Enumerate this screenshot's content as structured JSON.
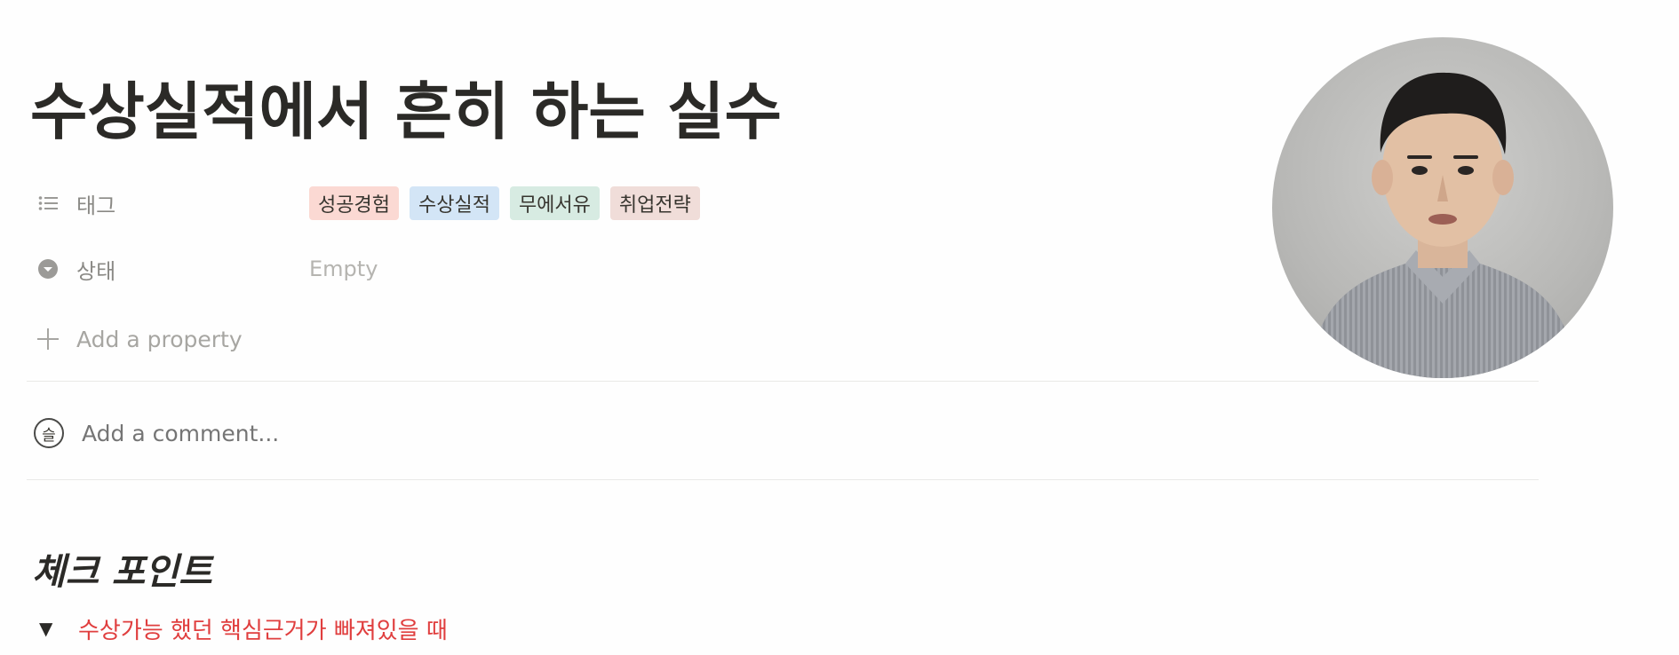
{
  "page": {
    "title": "수상실적에서 흔히 하는 실수"
  },
  "properties": {
    "tags": {
      "name": "태그",
      "icon": "list-icon",
      "values": [
        {
          "label": "성공경험",
          "color": "#fbd9d3"
        },
        {
          "label": "수상실적",
          "color": "#d3e5f6"
        },
        {
          "label": "무에서유",
          "color": "#d7ebe2"
        },
        {
          "label": "취업전략",
          "color": "#f0ddd9"
        }
      ]
    },
    "status": {
      "name": "상태",
      "icon": "status-icon",
      "value": "Empty"
    },
    "add_property": {
      "icon": "plus-icon",
      "label": "Add a property"
    }
  },
  "comment": {
    "avatar_letter": "슬",
    "placeholder": "Add a comment..."
  },
  "content": {
    "heading": "체크 포인트",
    "toggle": {
      "text": "수상가능 했던 핵심근거가 빠져있을 때",
      "color": "#e03e3e"
    }
  },
  "video_overlay": {
    "shape": "circle"
  }
}
